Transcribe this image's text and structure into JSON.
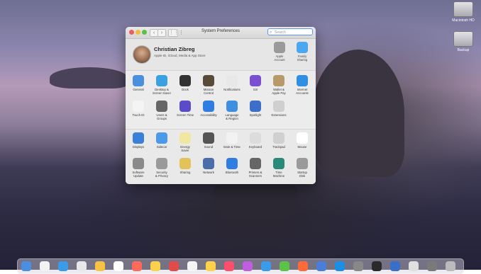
{
  "window": {
    "title": "System Preferences",
    "search_placeholder": "Search",
    "back_label": "‹",
    "forward_label": "›",
    "grid_label": "⋮⋮⋮"
  },
  "account": {
    "name": "Christian Zibreg",
    "subtitle": "Apple ID, iCloud, Media & App Store",
    "items": [
      {
        "label": "Apple\nAccount",
        "icon": "apple-icon",
        "color": "#9a9a9a"
      },
      {
        "label": "Family\nSharing",
        "icon": "cloud-icon",
        "color": "#4aa7f0"
      }
    ]
  },
  "row1": [
    {
      "label": "General",
      "icon": "general-icon",
      "color": "#4c8fdc"
    },
    {
      "label": "Desktop &\nScreen Saver",
      "icon": "desktop-icon",
      "color": "#3aa0e0"
    },
    {
      "label": "Dock",
      "icon": "dock-icon",
      "color": "#333333"
    },
    {
      "label": "Mission\nControl",
      "icon": "mission-control-icon",
      "color": "#5a4a3a"
    },
    {
      "label": "Notifications",
      "icon": "notifications-icon",
      "color": "#e8e8e8"
    },
    {
      "label": "Siri",
      "icon": "siri-icon",
      "color": "#7a4fd0"
    },
    {
      "label": "Wallet &\nApple Pay",
      "icon": "wallet-icon",
      "color": "#b89a6a"
    },
    {
      "label": "Internet\nAccounts",
      "icon": "at-icon",
      "color": "#2f8fe3"
    }
  ],
  "row2": [
    {
      "label": "Touch ID",
      "icon": "fingerprint-icon",
      "color": "#f4f4f4"
    },
    {
      "label": "Users &\nGroups",
      "icon": "users-icon",
      "color": "#666666"
    },
    {
      "label": "Screen Time",
      "icon": "hourglass-icon",
      "color": "#5a4bc8"
    },
    {
      "label": "Accessibility",
      "icon": "accessibility-icon",
      "color": "#2f7de0"
    },
    {
      "label": "Language\n& Region",
      "icon": "globe-icon",
      "color": "#3f8fe0"
    },
    {
      "label": "Spotlight",
      "icon": "spotlight-icon",
      "color": "#3e6fc8"
    },
    {
      "label": "Extensions",
      "icon": "puzzle-icon",
      "color": "#cfcfcf"
    }
  ],
  "row3": [
    {
      "label": "Displays",
      "icon": "display-icon",
      "color": "#3a7fd8"
    },
    {
      "label": "Sidecar",
      "icon": "sidecar-icon",
      "color": "#4a9ae8"
    },
    {
      "label": "Energy\nSaver",
      "icon": "lightbulb-icon",
      "color": "#f0e7a0"
    },
    {
      "label": "Sound",
      "icon": "speaker-icon",
      "color": "#555555"
    },
    {
      "label": "Date & Time",
      "icon": "clock-icon",
      "color": "#f2f2f2"
    },
    {
      "label": "Keyboard",
      "icon": "keyboard-icon",
      "color": "#dcdcdc"
    },
    {
      "label": "Trackpad",
      "icon": "trackpad-icon",
      "color": "#d0d0d0"
    },
    {
      "label": "Mouse",
      "icon": "mouse-icon",
      "color": "#ffffff"
    }
  ],
  "row4": [
    {
      "label": "Software\nUpdate",
      "icon": "gear-icon",
      "color": "#8a8a8a"
    },
    {
      "label": "Security\n& Privacy",
      "icon": "house-lock-icon",
      "color": "#9a9a9a"
    },
    {
      "label": "Sharing",
      "icon": "sharing-icon",
      "color": "#e3c25a"
    },
    {
      "label": "Network",
      "icon": "network-icon",
      "color": "#4a6fa8"
    },
    {
      "label": "Bluetooth",
      "icon": "bluetooth-icon",
      "color": "#2f7de0"
    },
    {
      "label": "Printers &\nScanners",
      "icon": "printer-icon",
      "color": "#666666"
    },
    {
      "label": "Time\nMachine",
      "icon": "time-machine-icon",
      "color": "#2a8a7a"
    },
    {
      "label": "Startup\nDisk",
      "icon": "disk-icon",
      "color": "#9a9a9a"
    }
  ],
  "desktop_icons": [
    {
      "label": "Macintosh HD"
    },
    {
      "label": "Backup"
    }
  ]
}
